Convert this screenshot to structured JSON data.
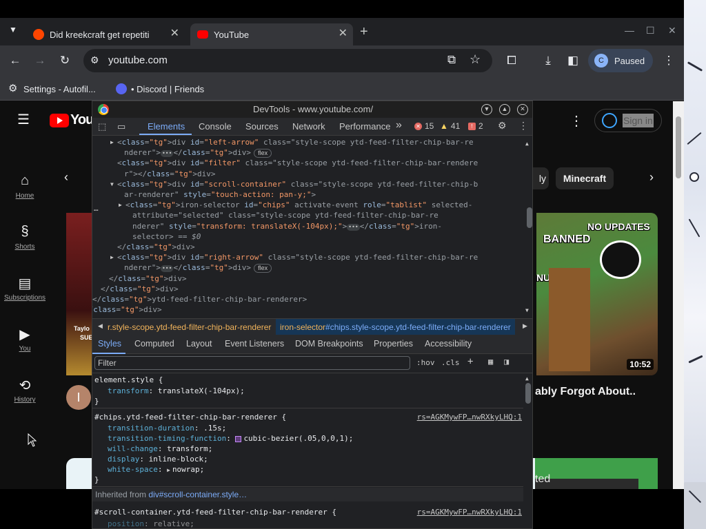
{
  "browser": {
    "tabs": [
      {
        "title": "Did kreekcraft get repetiti",
        "close": "✕"
      },
      {
        "title": "YouTube",
        "close": "✕"
      }
    ],
    "new_tab": "+",
    "url": "youtube.com",
    "profile_initial": "C",
    "profile_status": "Paused",
    "bookmarks": [
      "Settings - Autofil...",
      "• Discord | Friends"
    ]
  },
  "youtube": {
    "sidebar": [
      {
        "label": "Home",
        "icon": "home-icon"
      },
      {
        "label": "Shorts",
        "icon": "shorts-icon"
      },
      {
        "label": "Subscriptions",
        "icon": "subscriptions-icon"
      },
      {
        "label": "You",
        "icon": "you-icon"
      },
      {
        "label": "History",
        "icon": "history-icon"
      }
    ],
    "logo_text": "You",
    "chip_partial": "ly",
    "chip_minecraft": "Minecraft",
    "sign_in": "Sign in",
    "thumb_text_1": "NO UPDATES",
    "thumb_text_2": "BANNED",
    "thumb_text_3": "NUED",
    "duration": "10:52",
    "video_title": "ably Forgot About..",
    "left_avatar": "I",
    "left_thumb_text_1": "Taylo",
    "left_thumb_text_2": "SUE",
    "bottom_card_text": "ted"
  },
  "devtools": {
    "title": "DevTools - www.youtube.com/",
    "tabs": [
      "Elements",
      "Console",
      "Sources",
      "Network",
      "Performance"
    ],
    "more": "»",
    "errors": "15",
    "warnings": "41",
    "issues": "2",
    "dom_lines": [
      {
        "indent": 0,
        "arrow": "▶",
        "html": "<div id=\"left-arrow\" class=\"style-scope ytd-feed-filter-chip-bar-re"
      },
      {
        "indent": 0,
        "arrow": "",
        "html": "nderer\">…</div>",
        "pill": "flex"
      },
      {
        "indent": 0,
        "arrow": "",
        "html": "<div id=\"filter\" class=\"style-scope ytd-feed-filter-chip-bar-rendere"
      },
      {
        "indent": 0,
        "arrow": "",
        "html": "r\"></div>"
      },
      {
        "indent": 0,
        "arrow": "▼",
        "html": "<div id=\"scroll-container\" class=\"style-scope ytd-feed-filter-chip-b"
      },
      {
        "indent": 0,
        "arrow": "",
        "html": "ar-renderer\" style=\"touch-action: pan-y;\">"
      },
      {
        "indent": 1,
        "arrow": "▶",
        "html": "<iron-selector id=\"chips\" activate-event role=\"tablist\" selected-"
      },
      {
        "indent": 1,
        "arrow": "",
        "html": "attribute=\"selected\" class=\"style-scope ytd-feed-filter-chip-bar-re"
      },
      {
        "indent": 1,
        "arrow": "",
        "html": "nderer\" style=\"transform: translateX(-104px);\">…</iron-"
      },
      {
        "indent": 1,
        "arrow": "",
        "html": "selector> == $0"
      },
      {
        "indent": 0,
        "arrow": "",
        "html": "</div>"
      },
      {
        "indent": 0,
        "arrow": "▶",
        "html": "<div id=\"right-arrow\" class=\"style-scope ytd-feed-filter-chip-bar-re"
      },
      {
        "indent": 0,
        "arrow": "",
        "html": "nderer\">…</div>",
        "pill": "flex"
      },
      {
        "indent": -1,
        "arrow": "",
        "html": "</div>"
      },
      {
        "indent": -2,
        "arrow": "",
        "html": "</div>"
      },
      {
        "indent": -3,
        "arrow": "",
        "html": "</ytd-feed-filter-chip-bar-renderer>"
      },
      {
        "indent": -4,
        "arrow": "",
        "html": "</div>"
      }
    ],
    "breadcrumb_1": "r.style-scope.ytd-feed-filter-chip-bar-renderer",
    "breadcrumb_2_tag": "iron-selector",
    "breadcrumb_2_rest": "#chips.style-scope.ytd-feed-filter-chip-bar-renderer",
    "subtabs": [
      "Styles",
      "Computed",
      "Layout",
      "Event Listeners",
      "DOM Breakpoints",
      "Properties",
      "Accessibility"
    ],
    "filter_placeholder": "Filter",
    "hov": ":hov",
    "cls": ".cls",
    "rules": {
      "element_selector": "element.style {",
      "element_prop": "transform",
      "element_val": "translateX(-104px);",
      "close": "}",
      "chips_selector": "#chips.ytd-feed-filter-chip-bar-renderer {",
      "chips_source": "rs=AGKMywFP…nwRXkyLHQ:1",
      "chips_props": [
        {
          "name": "transition-duration",
          "value": ".15s;"
        },
        {
          "name": "transition-timing-function",
          "value": "cubic-bezier(.05,0,0,1);"
        },
        {
          "name": "will-change",
          "value": "transform;"
        },
        {
          "name": "display",
          "value": "inline-block;"
        },
        {
          "name": "white-space",
          "value": "nowrap;"
        }
      ],
      "inherited_label": "Inherited from",
      "inherited_target": "div#scroll-container.style…",
      "scroll_selector": "#scroll-container.ytd-feed-filter-chip-bar-renderer {",
      "scroll_source": "rs=AGKMywFP…nwRXkyLHQ:1",
      "scroll_prop": "position",
      "scroll_val": "relative;"
    }
  },
  "colors": {
    "accent": "#7cacf8",
    "yt_red": "#ff0000"
  }
}
